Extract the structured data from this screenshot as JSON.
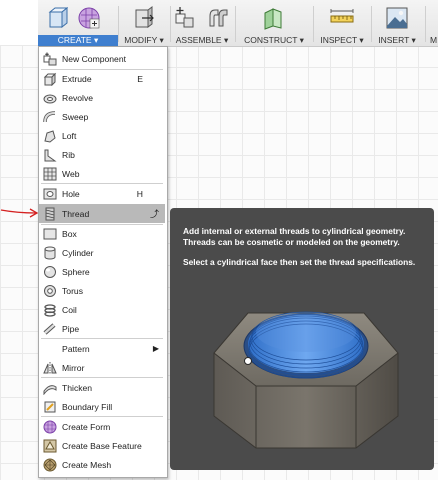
{
  "toolbar": {
    "groups": [
      {
        "label": "CREATE ▾",
        "icons": [
          "extrude-box-icon",
          "create-form-grid-icon"
        ]
      },
      {
        "label": "MODIFY ▾",
        "icons": [
          "press-pull-icon"
        ]
      },
      {
        "label": "ASSEMBLE ▾",
        "icons": [
          "new-component-icon",
          "joint-icon"
        ]
      },
      {
        "label": "CONSTRUCT ▾",
        "icons": [
          "offset-plane-icon"
        ]
      },
      {
        "label": "INSPECT ▾",
        "icons": [
          "measure-icon"
        ]
      },
      {
        "label": "INSERT ▾",
        "icons": [
          "insert-image-icon"
        ]
      },
      {
        "label": "M",
        "icons": []
      }
    ]
  },
  "menu": {
    "items": [
      {
        "label": "New Component",
        "icon": "new-component-icon",
        "shortcut": ""
      },
      {
        "label": "Extrude",
        "icon": "extrude-icon",
        "shortcut": "E"
      },
      {
        "label": "Revolve",
        "icon": "revolve-icon",
        "shortcut": ""
      },
      {
        "label": "Sweep",
        "icon": "sweep-icon",
        "shortcut": ""
      },
      {
        "label": "Loft",
        "icon": "loft-icon",
        "shortcut": ""
      },
      {
        "label": "Rib",
        "icon": "rib-icon",
        "shortcut": ""
      },
      {
        "label": "Web",
        "icon": "web-icon",
        "shortcut": ""
      },
      {
        "label": "Hole",
        "icon": "hole-icon",
        "shortcut": "H"
      },
      {
        "label": "Thread",
        "icon": "thread-icon",
        "shortcut": "",
        "highlighted": true
      },
      {
        "label": "Box",
        "icon": "box-icon",
        "shortcut": ""
      },
      {
        "label": "Cylinder",
        "icon": "cylinder-icon",
        "shortcut": ""
      },
      {
        "label": "Sphere",
        "icon": "sphere-icon",
        "shortcut": ""
      },
      {
        "label": "Torus",
        "icon": "torus-icon",
        "shortcut": ""
      },
      {
        "label": "Coil",
        "icon": "coil-icon",
        "shortcut": ""
      },
      {
        "label": "Pipe",
        "icon": "pipe-icon",
        "shortcut": ""
      },
      {
        "label": "Pattern",
        "icon": "",
        "shortcut": "",
        "submenu": true
      },
      {
        "label": "Mirror",
        "icon": "mirror-icon",
        "shortcut": ""
      },
      {
        "label": "Thicken",
        "icon": "thicken-icon",
        "shortcut": ""
      },
      {
        "label": "Boundary Fill",
        "icon": "boundary-fill-icon",
        "shortcut": ""
      },
      {
        "label": "Create Form",
        "icon": "create-form-icon",
        "shortcut": ""
      },
      {
        "label": "Create Base Feature",
        "icon": "base-feature-icon",
        "shortcut": ""
      },
      {
        "label": "Create Mesh",
        "icon": "create-mesh-icon",
        "shortcut": ""
      }
    ]
  },
  "tooltip": {
    "line1": "Add internal or external threads to cylindrical geometry. Threads can be cosmetic or modeled on the geometry.",
    "line2": "Select a cylindrical face then set the thread specifications."
  },
  "colors": {
    "accent": "#3f7fcf",
    "highlight": "#b9b9b9",
    "tooltip_bg": "#4b4b4b",
    "thread_blue": "#3a7fd8",
    "annotation_red": "#d42020"
  }
}
